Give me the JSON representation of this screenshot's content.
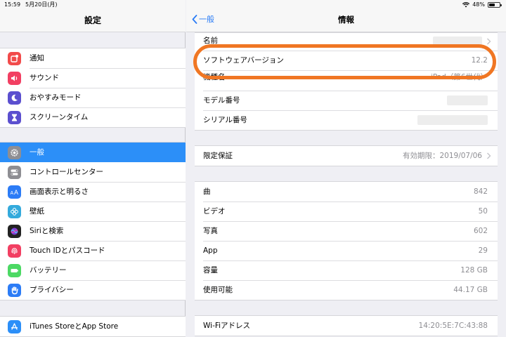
{
  "status_bar": {
    "time": "15:59",
    "date": "5月20日(月)",
    "battery": "48%",
    "battery_level": 0.48
  },
  "left": {
    "title": "設定",
    "group1": [
      {
        "label": "通知",
        "icon": "notifications-icon",
        "color": "#f24b4b"
      },
      {
        "label": "サウンド",
        "icon": "sound-icon",
        "color": "#f23f62"
      },
      {
        "label": "おやすみモード",
        "icon": "moon-icon",
        "color": "#5b4fcf"
      },
      {
        "label": "スクリーンタイム",
        "icon": "hourglass-icon",
        "color": "#5b4fcf"
      }
    ],
    "group2": [
      {
        "label": "一般",
        "icon": "gear-icon",
        "color": "#8e8e93",
        "selected": true
      },
      {
        "label": "コントロールセンター",
        "icon": "toggles-icon",
        "color": "#8e8e93"
      },
      {
        "label": "画面表示と明るさ",
        "icon": "text-size-icon",
        "color": "#2c7cf6"
      },
      {
        "label": "壁紙",
        "icon": "flower-icon",
        "color": "#34aadc"
      },
      {
        "label": "Siriと検索",
        "icon": "siri-icon",
        "color": "#222222"
      },
      {
        "label": "Touch IDとパスコード",
        "icon": "fingerprint-icon",
        "color": "#f23f62"
      },
      {
        "label": "バッテリー",
        "icon": "battery-icon",
        "color": "#4cd964"
      },
      {
        "label": "プライバシー",
        "icon": "hand-icon",
        "color": "#2c7cf6"
      }
    ],
    "group3": [
      {
        "label": "iTunes StoreとApp Store",
        "icon": "app-store-icon",
        "color": "#2c8ff8"
      }
    ]
  },
  "right": {
    "back_label": "一般",
    "title": "情報",
    "group1": [
      {
        "label": "名前",
        "value": ""
      },
      {
        "label": "ソフトウェアバージョン",
        "value": "12.2"
      },
      {
        "label": "機種名",
        "value": "iPad（第6世代）"
      },
      {
        "label": "モデル番号",
        "value": ""
      },
      {
        "label": "シリアル番号",
        "value": ""
      }
    ],
    "warranty": {
      "label": "限定保証",
      "value": "有効期限：2019/07/06"
    },
    "group3": [
      {
        "label": "曲",
        "value": "842"
      },
      {
        "label": "ビデオ",
        "value": "50"
      },
      {
        "label": "写真",
        "value": "602"
      },
      {
        "label": "App",
        "value": "29"
      },
      {
        "label": "容量",
        "value": "128 GB"
      },
      {
        "label": "使用可能",
        "value": "44.17 GB"
      }
    ],
    "group4": [
      {
        "label": "Wi-Fiアドレス",
        "value": "14:20:5E:7C:43:88"
      }
    ]
  },
  "colors": {
    "accent": "#2c8ff8",
    "highlight": "#f07623"
  }
}
